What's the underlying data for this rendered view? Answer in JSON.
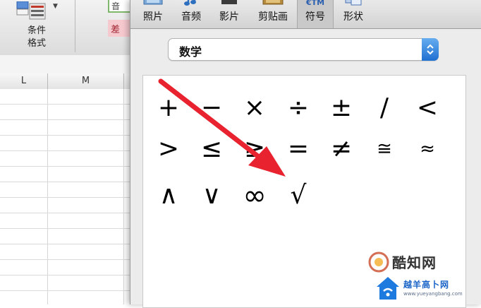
{
  "ribbon": {
    "conditional_format_label_line1": "条件",
    "conditional_format_label_line2": "格式",
    "cell_preview_text": "音",
    "bad_style_text": "差"
  },
  "sheet": {
    "columns": [
      "L",
      "M"
    ]
  },
  "media_browser": {
    "tabs": [
      {
        "label": "照片",
        "icon": "photo-icon"
      },
      {
        "label": "音频",
        "icon": "music-note-icon"
      },
      {
        "label": "影片",
        "icon": "film-icon"
      },
      {
        "label": "剪贴画",
        "icon": "clipart-icon"
      },
      {
        "label": "符号",
        "icon": "symbol-icon",
        "icon_text": "€TM",
        "active": true
      },
      {
        "label": "形状",
        "icon": "shape-icon"
      }
    ],
    "category": "数学",
    "symbols": [
      "+",
      "−",
      "×",
      "÷",
      "±",
      "/",
      "<",
      ">",
      "≤",
      "≥",
      "=",
      "≠",
      "≅",
      "≈",
      "∧",
      "∨",
      "∞",
      "√"
    ]
  },
  "annotation": {
    "arrow_color": "#e8232f",
    "target_symbol": "√"
  },
  "watermarks": {
    "cool_text": "酷知网",
    "site_text": "越羊高卜网",
    "site_url": "www.yueyangbang.com"
  },
  "colors": {
    "accent": "#2a7de1",
    "arrow": "#e8232f",
    "panel_bg": "#ececec"
  }
}
